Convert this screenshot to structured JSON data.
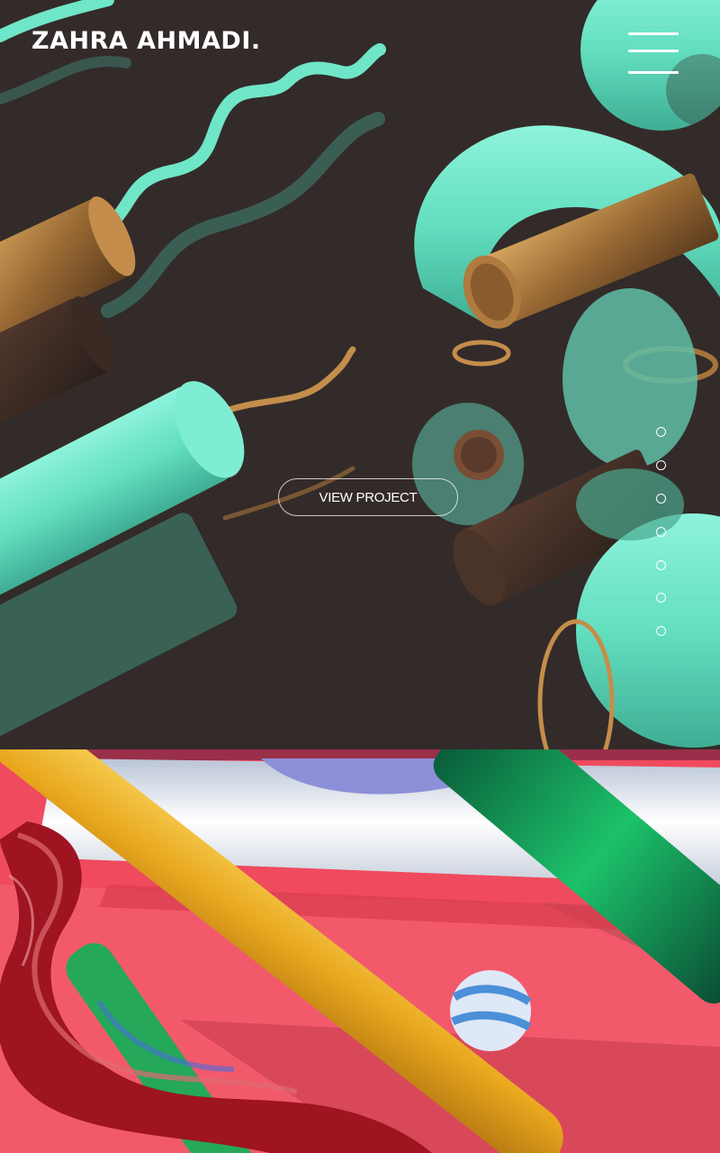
{
  "header": {
    "logo_text": "ZAHRA AHMADI.",
    "menu_icon": "hamburger-menu-icon"
  },
  "hero": {
    "cta_label": "VIEW PROJECT",
    "artwork": "abstract 3D mint tubes, bronze cylinders and wavy ribbons on dark brown background"
  },
  "pagination": {
    "count": 7,
    "icon": "circle-outline-icon"
  },
  "second_section": {
    "artwork": "abstract 3D yellow, green and red glass tubes over pink and white stripes"
  },
  "colors": {
    "hero_background": "#332b29",
    "mint": "#6fe6c8",
    "bronze": "#a8743c",
    "coral": "#f04a5e",
    "yellow_tube": "#f0b42c",
    "green_tube": "#1fb060",
    "text": "#ffffff"
  }
}
